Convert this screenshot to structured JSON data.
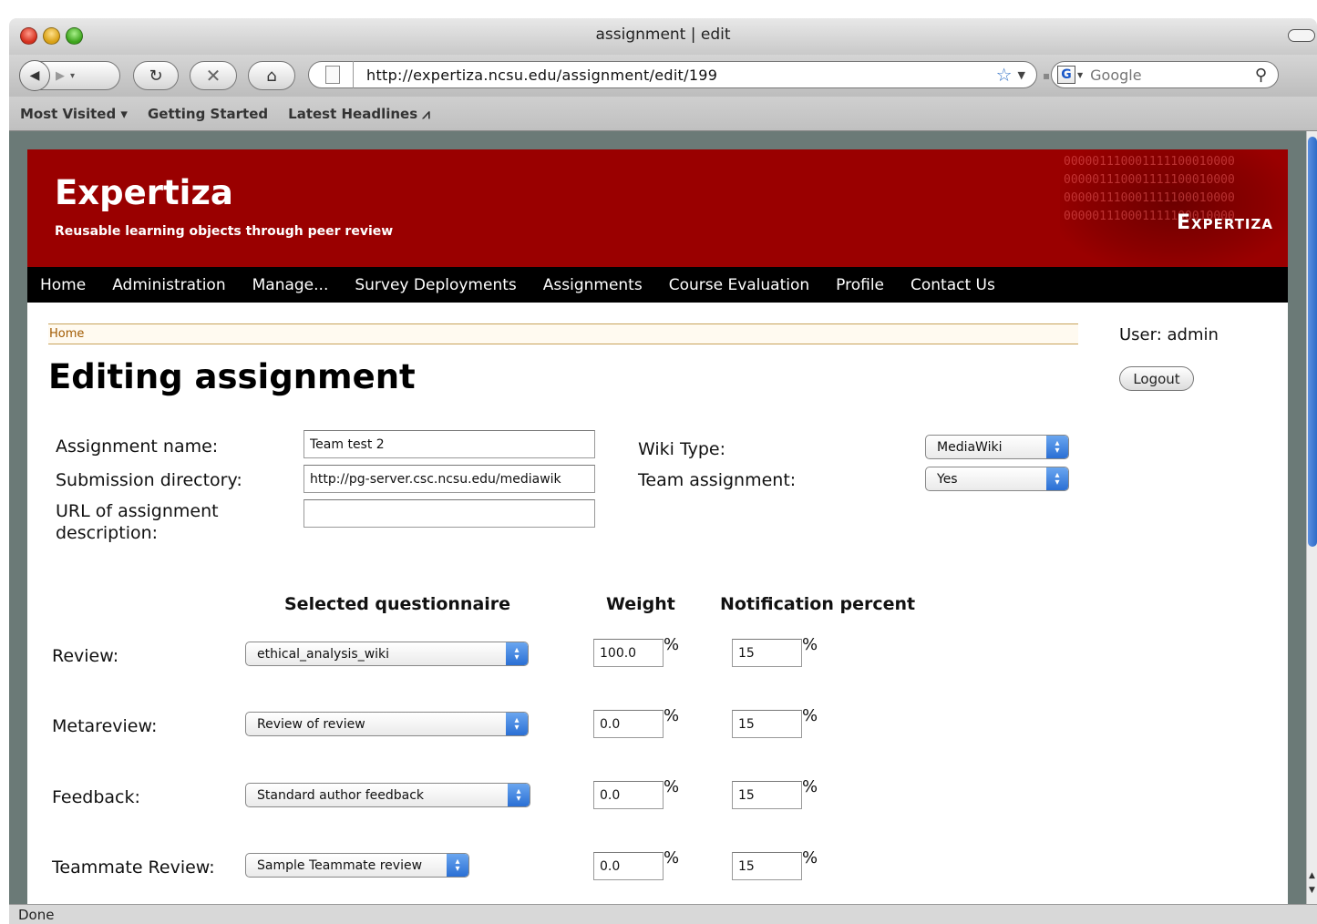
{
  "window": {
    "title": "assignment | edit"
  },
  "toolbar": {
    "url": "http://expertiza.ncsu.edu/assignment/edit/199",
    "search_placeholder": "Google"
  },
  "bookmarks": [
    {
      "label": "Most Visited ▾"
    },
    {
      "label": "Getting Started"
    },
    {
      "label": "Latest Headlines ⩘"
    }
  ],
  "site": {
    "title": "Expertiza",
    "tagline": "Reusable learning objects through peer review",
    "logo_text": "Expertiza",
    "binary_text": "000001110001111100010000\n000001110001111100010000\n000001110001111100010000\n000001110001111100010000",
    "nav": [
      "Home",
      "Administration",
      "Manage...",
      "Survey Deployments",
      "Assignments",
      "Course Evaluation",
      "Profile",
      "Contact Us"
    ],
    "breadcrumb": "Home",
    "user_label": "User: admin",
    "logout_label": "Logout"
  },
  "form": {
    "heading": "Editing assignment",
    "assignment_name_label": "Assignment name:",
    "assignment_name_value": "Team test 2",
    "submission_dir_label": "Submission directory:",
    "submission_dir_value": "http://pg-server.csc.ncsu.edu/mediawik",
    "url_desc_label": "URL of assignment description:",
    "url_desc_value": "",
    "wiki_type_label": "Wiki Type:",
    "wiki_type_value": "MediaWiki",
    "team_assignment_label": "Team assignment:",
    "team_assignment_value": "Yes"
  },
  "questionnaires": {
    "headers": {
      "selected": "Selected questionnaire",
      "weight": "Weight",
      "notification": "Notification percent"
    },
    "percent_symbol": "%",
    "rows": [
      {
        "label": "Review:",
        "questionnaire": "ethical_analysis_wiki",
        "weight": "100.0",
        "notification": "15"
      },
      {
        "label": "Metareview:",
        "questionnaire": "Review of review",
        "weight": "0.0",
        "notification": "15"
      },
      {
        "label": "Feedback:",
        "questionnaire": "Standard author feedback",
        "weight": "0.0",
        "notification": "15"
      },
      {
        "label": "Teammate Review:",
        "questionnaire": "Sample Teammate review",
        "weight": "0.0",
        "notification": "15"
      }
    ]
  },
  "status": {
    "text": "Done"
  }
}
